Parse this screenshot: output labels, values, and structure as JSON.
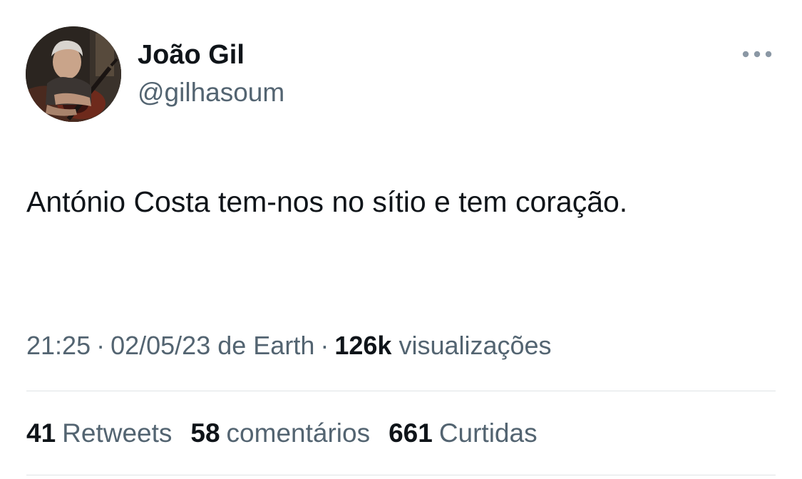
{
  "tweet": {
    "author": {
      "display_name": "João Gil",
      "handle": "@gilhasoum",
      "avatar_icon": "avatar-photo"
    },
    "more_icon": "more-horizontal-icon",
    "text": "António Costa tem-nos no sítio e tem coração.",
    "meta": {
      "time": "21:25",
      "separator": "·",
      "date": "02/05/23",
      "source": "de Earth",
      "views_count": "126k",
      "views_label": "visualizações"
    },
    "stats": {
      "retweets_count": "41",
      "retweets_label": "Retweets",
      "comments_count": "58",
      "comments_label": "comentários",
      "likes_count": "661",
      "likes_label": "Curtidas"
    }
  },
  "colors": {
    "primary_text": "#0f1419",
    "secondary_text": "#536471",
    "divider": "#dfe3e6",
    "background": "#ffffff"
  }
}
